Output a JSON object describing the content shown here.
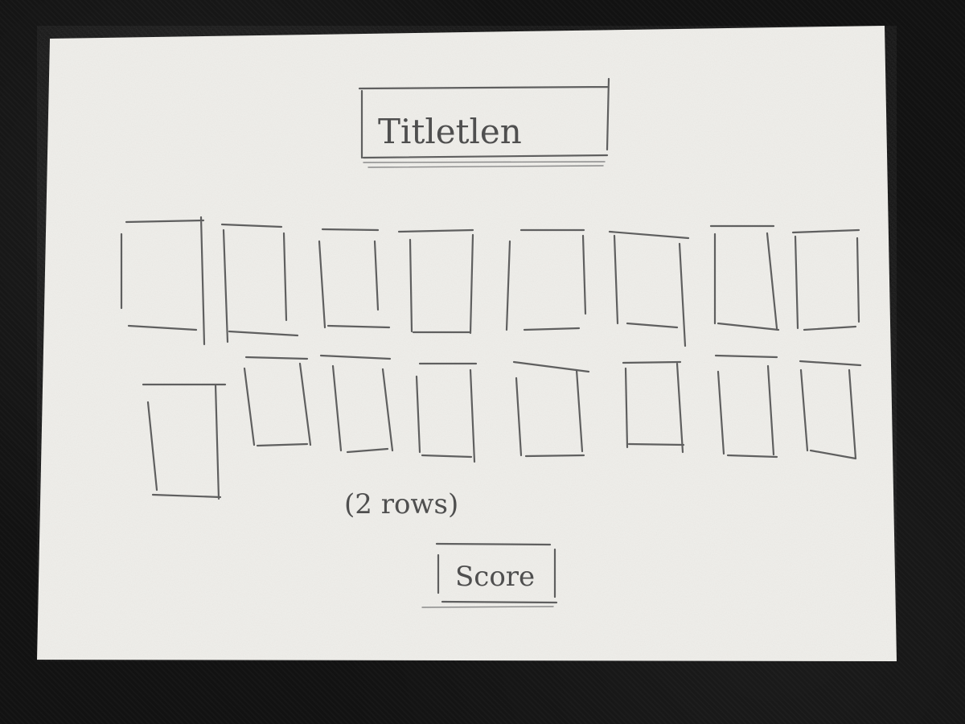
{
  "sketch": {
    "title_label": "Titletlen",
    "rows_note": "(2 rows)",
    "score_label": "Score",
    "card_rows": 2,
    "cards_per_row": 8
  },
  "colors": {
    "paper": "#efeeea",
    "pencil": "#5f5f5f",
    "background": "#121212"
  }
}
